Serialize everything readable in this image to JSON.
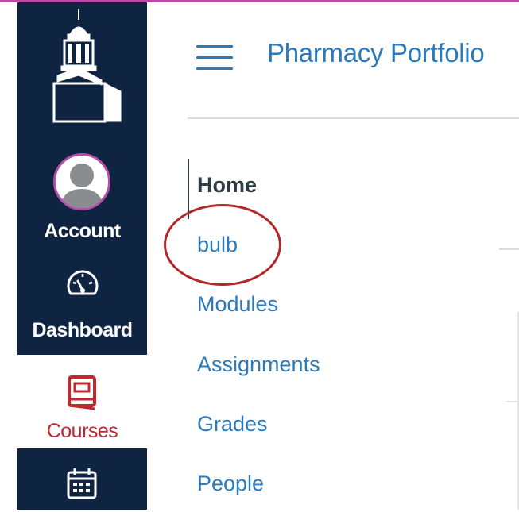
{
  "global_nav": {
    "account_label": "Account",
    "dashboard_label": "Dashboard",
    "courses_label": "Courses"
  },
  "course": {
    "title": "Pharmacy Portfolio"
  },
  "course_nav": {
    "items": [
      {
        "label": "Home",
        "active": true
      },
      {
        "label": "bulb",
        "active": false
      },
      {
        "label": "Modules",
        "active": false
      },
      {
        "label": "Assignments",
        "active": false
      },
      {
        "label": "Grades",
        "active": false
      },
      {
        "label": "People",
        "active": false
      }
    ]
  },
  "colors": {
    "nav_background": "#0f2440",
    "link": "#2b7abc",
    "active_text": "#2d3b45",
    "courses_accent": "#c0282f",
    "brand_accent": "#b14fa9",
    "annotation": "#b22828"
  },
  "icons": {
    "logo": "clock-tower-logo",
    "account": "user-avatar",
    "dashboard": "speedometer-icon",
    "courses": "book-icon",
    "calendar": "calendar-icon",
    "menu": "hamburger-menu-icon"
  }
}
